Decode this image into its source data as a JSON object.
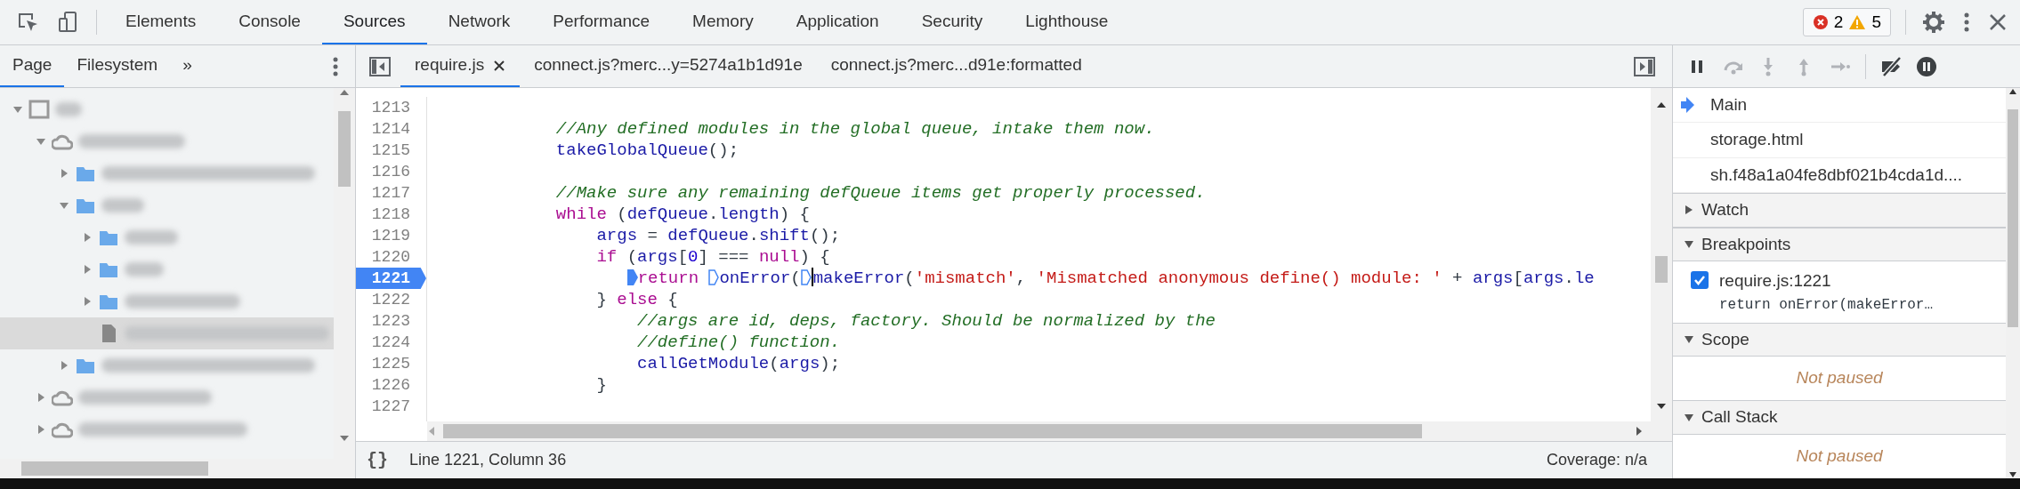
{
  "toolbar": {
    "tabs": [
      {
        "label": "Elements",
        "selected": false
      },
      {
        "label": "Console",
        "selected": false
      },
      {
        "label": "Sources",
        "selected": true
      },
      {
        "label": "Network",
        "selected": false
      },
      {
        "label": "Performance",
        "selected": false
      },
      {
        "label": "Memory",
        "selected": false
      },
      {
        "label": "Application",
        "selected": false
      },
      {
        "label": "Security",
        "selected": false
      },
      {
        "label": "Lighthouse",
        "selected": false
      }
    ],
    "errors": "2",
    "warnings": "5"
  },
  "navigator": {
    "tabs": [
      {
        "label": "Page",
        "selected": true
      },
      {
        "label": "Filesystem",
        "selected": false
      }
    ],
    "more": "»",
    "tree": [
      {
        "kind": "frame",
        "expanded": true,
        "selected": false,
        "children": [
          {
            "kind": "domain",
            "expanded": true,
            "selected": false,
            "children": [
              {
                "kind": "folder",
                "expanded": false,
                "selected": false
              },
              {
                "kind": "folder",
                "expanded": true,
                "selected": false,
                "children": [
                  {
                    "kind": "folder",
                    "expanded": false,
                    "selected": false
                  },
                  {
                    "kind": "folder",
                    "expanded": false,
                    "selected": false
                  },
                  {
                    "kind": "folder",
                    "expanded": false,
                    "selected": false
                  },
                  {
                    "kind": "file",
                    "selected": true
                  }
                ]
              },
              {
                "kind": "folder",
                "expanded": false,
                "selected": false
              }
            ]
          },
          {
            "kind": "domain",
            "expanded": false,
            "selected": false
          },
          {
            "kind": "domain",
            "expanded": false,
            "selected": false
          }
        ]
      }
    ]
  },
  "editor": {
    "tabs": [
      {
        "label": "require.js",
        "selected": true,
        "closable": true
      },
      {
        "label": "connect.js?merc...y=5274a1b1d91e",
        "selected": false,
        "closable": false
      },
      {
        "label": "connect.js?merc...d91e:formatted",
        "selected": false,
        "closable": false
      }
    ],
    "lines": [
      {
        "number": "1213",
        "breakpoint": false
      },
      {
        "number": "1214",
        "breakpoint": false,
        "tokens": [
          {
            "kind": "comment",
            "text": "            //Any defined modules in the global queue, intake them now."
          }
        ]
      },
      {
        "number": "1215",
        "breakpoint": false,
        "tokens": [
          {
            "kind": "ident",
            "text": "            takeGlobalQueue"
          },
          {
            "kind": "plain",
            "text": "();"
          }
        ]
      },
      {
        "number": "1216",
        "breakpoint": false
      },
      {
        "number": "1217",
        "breakpoint": false,
        "tokens": [
          {
            "kind": "comment",
            "text": "            //Make sure any remaining defQueue items get properly processed."
          }
        ]
      },
      {
        "number": "1218",
        "breakpoint": false,
        "tokens": [
          {
            "kind": "keyword",
            "text": "            while"
          },
          {
            "kind": "plain",
            "text": " ("
          },
          {
            "kind": "ident",
            "text": "defQueue"
          },
          {
            "kind": "plain",
            "text": "."
          },
          {
            "kind": "ident",
            "text": "length"
          },
          {
            "kind": "plain",
            "text": ") {"
          }
        ]
      },
      {
        "number": "1219",
        "breakpoint": false,
        "tokens": [
          {
            "kind": "ident",
            "text": "                args"
          },
          {
            "kind": "plain",
            "text": " = "
          },
          {
            "kind": "ident",
            "text": "defQueue"
          },
          {
            "kind": "plain",
            "text": "."
          },
          {
            "kind": "ident",
            "text": "shift"
          },
          {
            "kind": "plain",
            "text": "();"
          }
        ]
      },
      {
        "number": "1220",
        "breakpoint": false,
        "tokens": [
          {
            "kind": "keyword",
            "text": "                if"
          },
          {
            "kind": "plain",
            "text": " ("
          },
          {
            "kind": "ident",
            "text": "args"
          },
          {
            "kind": "plain",
            "text": "["
          },
          {
            "kind": "number",
            "text": "0"
          },
          {
            "kind": "plain",
            "text": "] === "
          },
          {
            "kind": "keyword",
            "text": "null"
          },
          {
            "kind": "plain",
            "text": ") {"
          }
        ]
      },
      {
        "number": "1221",
        "breakpoint": true,
        "tokens": [
          {
            "kind": "keyword",
            "text": "                   return",
            "active": true
          },
          {
            "kind": "ident",
            "text": " onError",
            "active": false
          },
          {
            "kind": "plain",
            "text": "("
          },
          {
            "kind": "ident",
            "text": "makeError",
            "active": false,
            "cursor": true
          },
          {
            "kind": "plain",
            "text": "("
          },
          {
            "kind": "string",
            "text": "'mismatch'"
          },
          {
            "kind": "plain",
            "text": ", "
          },
          {
            "kind": "string",
            "text": "'Mismatched anonymous define() module: '"
          },
          {
            "kind": "plain",
            "text": " + "
          },
          {
            "kind": "ident",
            "text": "args"
          },
          {
            "kind": "plain",
            "text": "["
          },
          {
            "kind": "ident",
            "text": "args"
          },
          {
            "kind": "plain",
            "text": "."
          },
          {
            "kind": "ident",
            "text": "le"
          }
        ]
      },
      {
        "number": "1222",
        "breakpoint": false,
        "tokens": [
          {
            "kind": "plain",
            "text": "                } "
          },
          {
            "kind": "keyword",
            "text": "else"
          },
          {
            "kind": "plain",
            "text": " {"
          }
        ]
      },
      {
        "number": "1223",
        "breakpoint": false,
        "tokens": [
          {
            "kind": "comment",
            "text": "                    //args are id, deps, factory. Should be normalized by the"
          }
        ]
      },
      {
        "number": "1224",
        "breakpoint": false,
        "tokens": [
          {
            "kind": "comment",
            "text": "                    //define() function."
          }
        ]
      },
      {
        "number": "1225",
        "breakpoint": false,
        "tokens": [
          {
            "kind": "ident",
            "text": "                    callGetModule"
          },
          {
            "kind": "plain",
            "text": "("
          },
          {
            "kind": "ident",
            "text": "args"
          },
          {
            "kind": "plain",
            "text": ");"
          }
        ]
      },
      {
        "number": "1226",
        "breakpoint": false,
        "tokens": [
          {
            "kind": "plain",
            "text": "                }"
          }
        ]
      },
      {
        "number": "1227",
        "breakpoint": false
      }
    ],
    "pretty_print": "{}",
    "position": "Line 1221, Column 36",
    "coverage": "Coverage: n/a"
  },
  "debugger": {
    "buttons": [
      {
        "kind": "pause",
        "disabled": false
      },
      {
        "kind": "step-over",
        "disabled": true
      },
      {
        "kind": "step-into",
        "disabled": true
      },
      {
        "kind": "step-out",
        "disabled": true
      },
      {
        "kind": "step",
        "disabled": true
      },
      {
        "kind": "deactivate-breakpoints",
        "disabled": false
      },
      {
        "kind": "pause-on-exceptions",
        "disabled": false
      }
    ],
    "threads": [
      {
        "name": "Main",
        "current": true
      },
      {
        "name": "storage.html",
        "current": false
      },
      {
        "name": "sh.f48a1a04fe8dbf021b4cda1d....",
        "current": false
      }
    ],
    "sections": [
      {
        "title": "Watch",
        "expanded": false
      },
      {
        "title": "Breakpoints",
        "expanded": true,
        "breakpoints": [
          {
            "location": "require.js:1221",
            "code": "return onError(makeError…",
            "checked": true
          }
        ]
      },
      {
        "title": "Scope",
        "expanded": true,
        "message": "Not paused"
      },
      {
        "title": "Call Stack",
        "expanded": true,
        "message": "Not paused"
      }
    ]
  }
}
